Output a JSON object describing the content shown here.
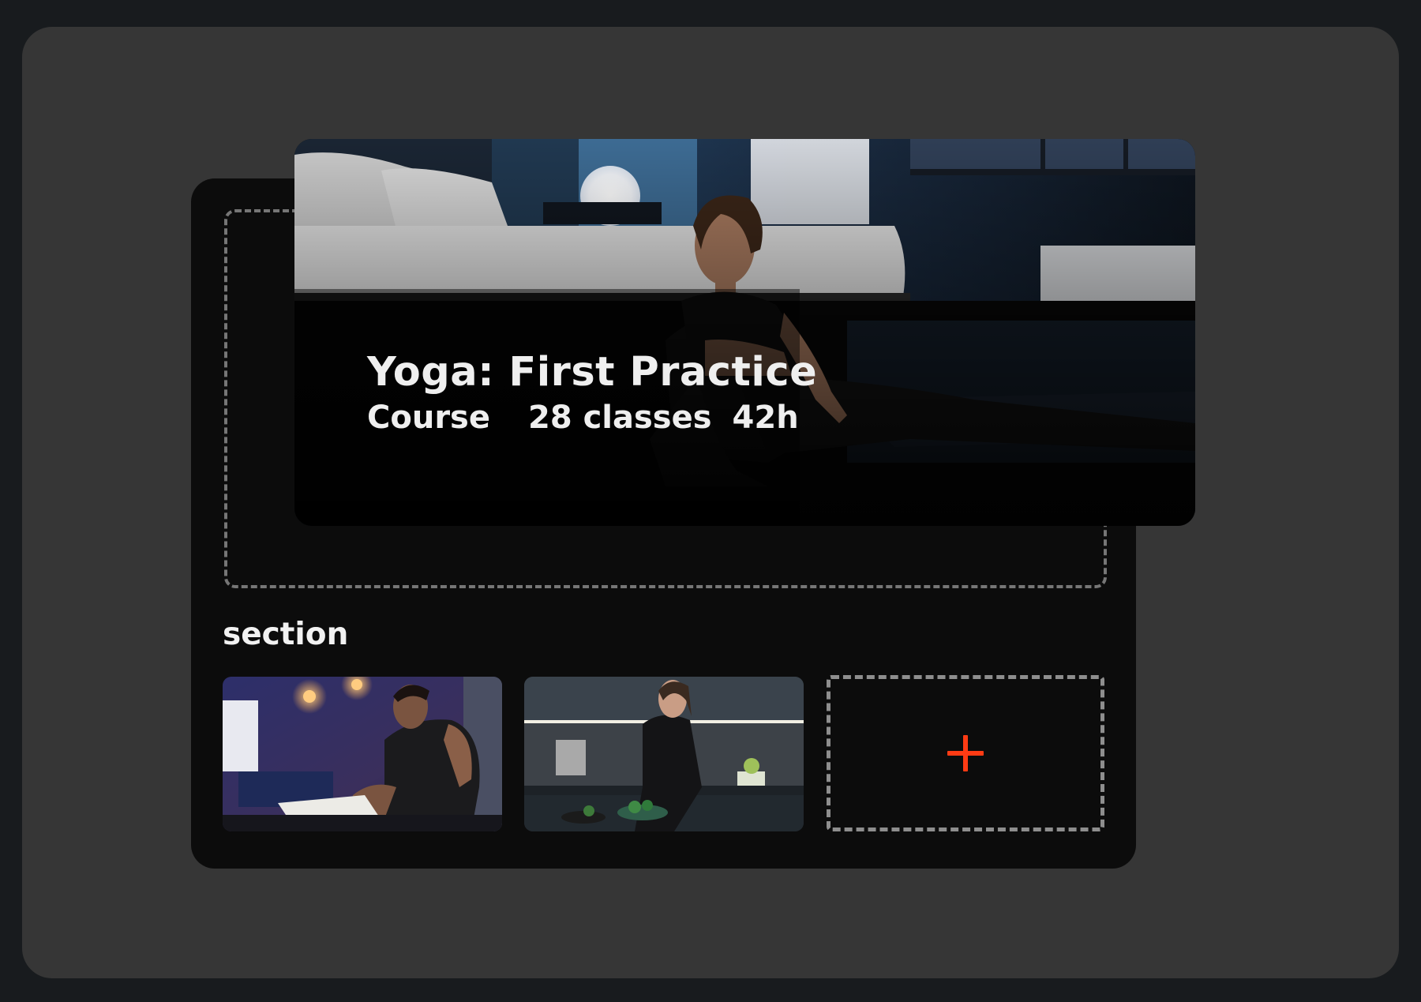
{
  "hero": {
    "title": "Yoga: First Practice",
    "type": "Course",
    "classes": "28 classes",
    "duration": "42h"
  },
  "section": {
    "label": "section",
    "items": [
      {
        "name": "thumbnail-man-writing"
      },
      {
        "name": "thumbnail-woman-cooking"
      }
    ],
    "add_icon": "plus-icon"
  },
  "colors": {
    "background": "#181b1e",
    "outer_panel": "#363636",
    "inner_panel": "#0c0c0c",
    "accent": "#ff3b14",
    "text": "#efefef"
  }
}
